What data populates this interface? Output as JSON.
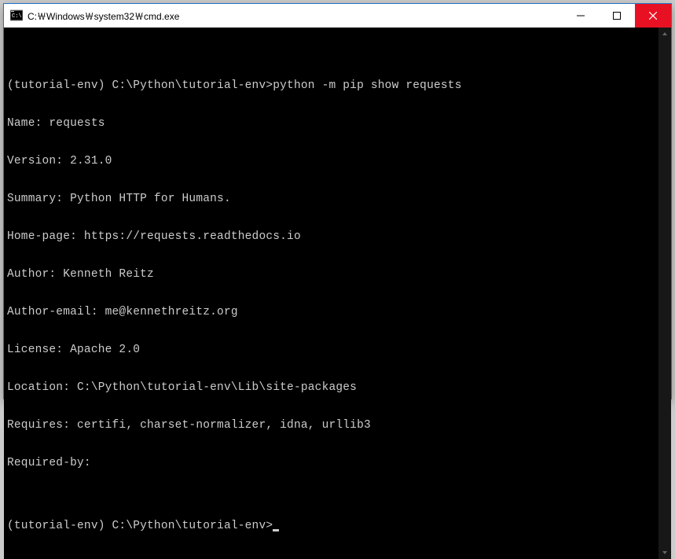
{
  "window": {
    "title": "C:￦Windows￦system32￦cmd.exe"
  },
  "terminal": {
    "lines": [
      "",
      "(tutorial-env) C:\\Python\\tutorial-env>python -m pip show requests",
      "Name: requests",
      "Version: 2.31.0",
      "Summary: Python HTTP for Humans.",
      "Home-page: https://requests.readthedocs.io",
      "Author: Kenneth Reitz",
      "Author-email: me@kennethreitz.org",
      "License: Apache 2.0",
      "Location: C:\\Python\\tutorial-env\\Lib\\site-packages",
      "Requires: certifi, charset-normalizer, idna, urllib3",
      "Required-by:",
      ""
    ],
    "prompt": "(tutorial-env) C:\\Python\\tutorial-env>"
  }
}
